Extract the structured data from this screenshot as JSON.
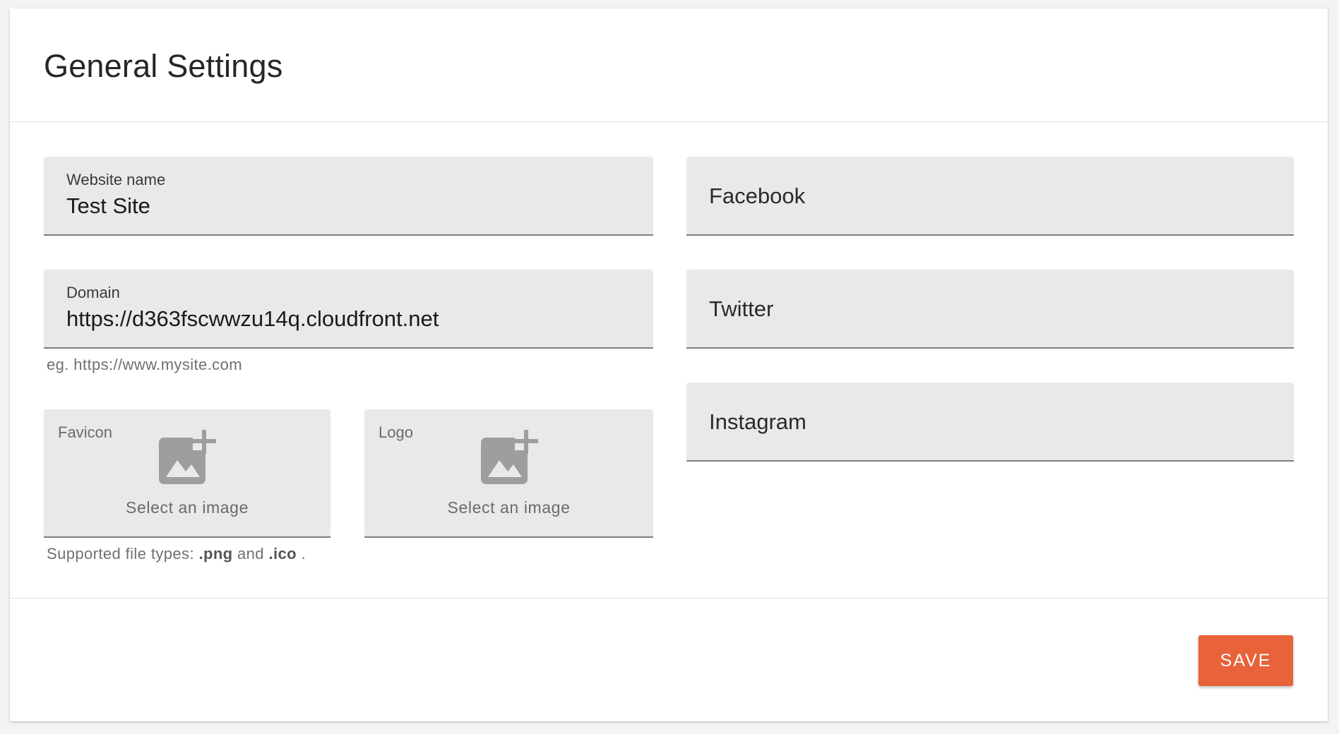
{
  "page": {
    "title": "General Settings"
  },
  "fields": {
    "website_name": {
      "label": "Website name",
      "value": "Test Site"
    },
    "domain": {
      "label": "Domain",
      "value": "https://d363fscwwzu14q.cloudfront.net",
      "helper": "eg. https://www.mysite.com"
    },
    "facebook": {
      "placeholder": "Facebook"
    },
    "twitter": {
      "placeholder": "Twitter"
    },
    "instagram": {
      "placeholder": "Instagram"
    }
  },
  "uploads": {
    "favicon": {
      "label": "Favicon",
      "text": "Select an image",
      "icon": "add-photo-icon"
    },
    "logo": {
      "label": "Logo",
      "text": "Select an image",
      "icon": "add-photo-icon"
    },
    "helper_prefix": "Supported file types: ",
    "type_png": ".png",
    "helper_and": " and ",
    "type_ico": ".ico",
    "helper_suffix": " ."
  },
  "footer": {
    "save_label": "SAVE"
  },
  "colors": {
    "accent": "#e8623a",
    "field_bg": "#e9e9e9",
    "field_border": "#7d7d7d",
    "icon": "#9e9e9e"
  }
}
